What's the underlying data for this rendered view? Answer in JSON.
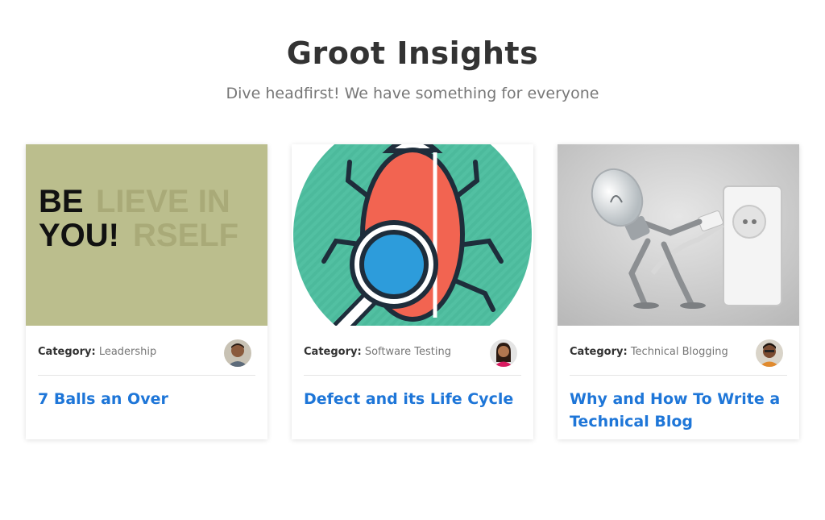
{
  "header": {
    "title": "Groot Insights",
    "subtitle": "Dive headfirst! We have something for everyone"
  },
  "colors": {
    "title": "#333333",
    "subtitle": "#777777",
    "link": "#1e76d8",
    "card_shadow": "rgba(0,0,0,0.13)"
  },
  "cards": [
    {
      "category_label": "Category:",
      "category": "Leadership",
      "title": "7 Balls an Over",
      "image": "believe-in-yourself-image",
      "image_text": [
        "BE",
        "LIEVE IN",
        "YOU!",
        "RSELF"
      ]
    },
    {
      "category_label": "Category:",
      "category": "Software Testing",
      "title": "Defect and its Life Cycle",
      "image": "bug-magnifier-image"
    },
    {
      "category_label": "Category:",
      "category": "Technical Blogging",
      "title": "Why and How To Write a Technical Blog",
      "image": "lightbulb-robot-plug-image"
    }
  ]
}
